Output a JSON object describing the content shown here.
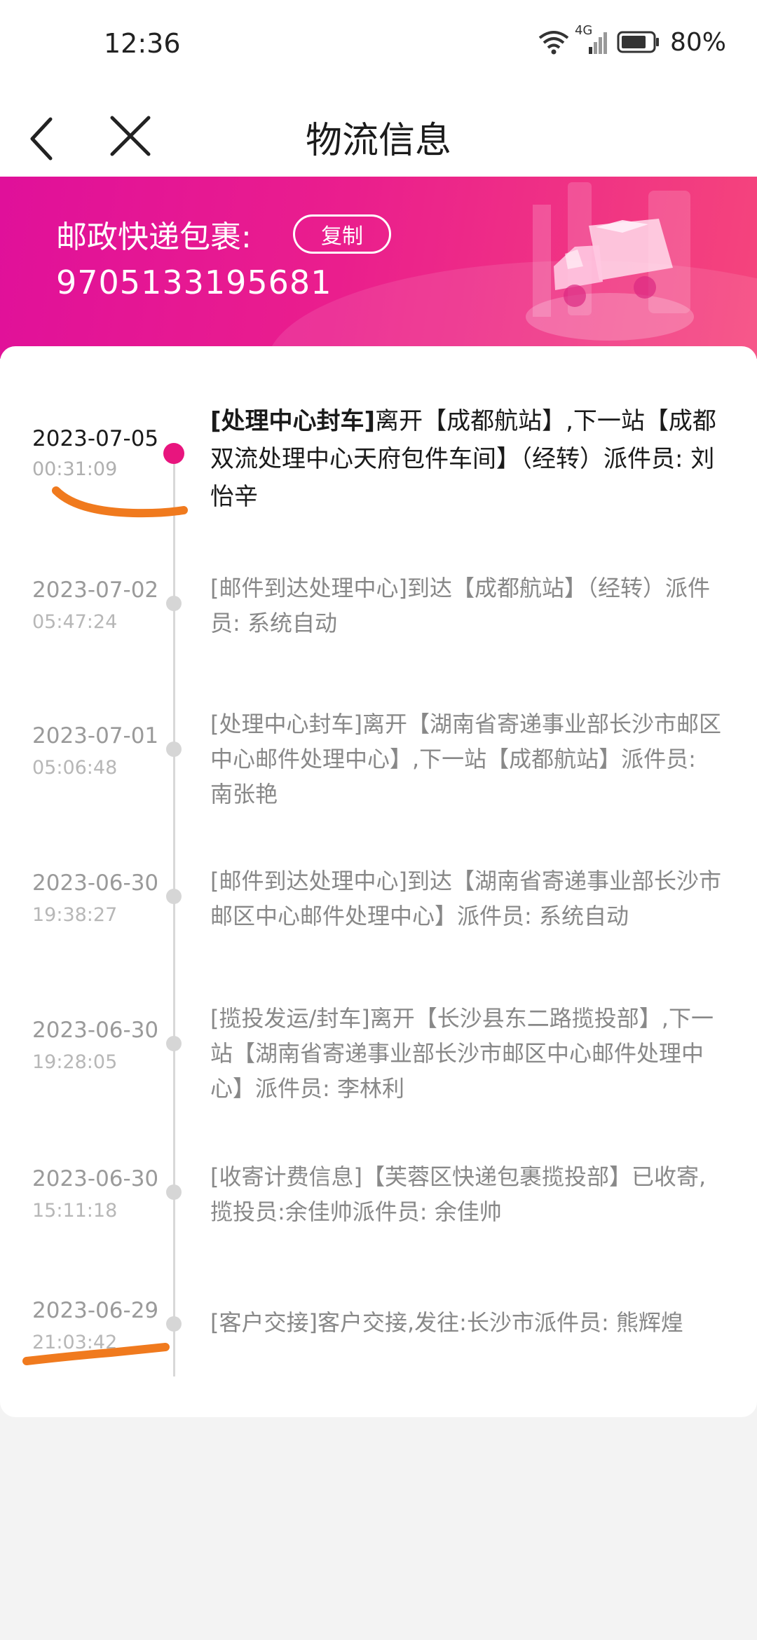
{
  "status_bar": {
    "time": "12:36",
    "network": "4G",
    "battery": "80%"
  },
  "nav": {
    "title": "物流信息",
    "back_icon": "chevron-left-icon",
    "close_icon": "close-icon"
  },
  "banner": {
    "carrier_label": "邮政快递包裹:",
    "copy_label": "复制",
    "tracking_number": "9705133195681",
    "illustration": "delivery-truck-icon"
  },
  "colors": {
    "accent": "#e8157e",
    "banner_start": "#e0109a",
    "banner_end": "#f5457c",
    "annotation": "#f07a1e"
  },
  "events": [
    {
      "date": "2023-07-05",
      "time": "00:31:09",
      "tag": "[处理中心封车]",
      "text": "离开【成都航站】,下一站【成都双流处理中心天府包件车间】（经转）派件员: 刘怡辛",
      "active": true
    },
    {
      "date": "2023-07-02",
      "time": "05:47:24",
      "tag": "[邮件到达处理中心]",
      "text": "到达【成都航站】（经转）派件员: 系统自动",
      "active": false
    },
    {
      "date": "2023-07-01",
      "time": "05:06:48",
      "tag": "[处理中心封车]",
      "text": "离开【湖南省寄递事业部长沙市邮区中心邮件处理中心】,下一站【成都航站】派件员: 南张艳",
      "active": false
    },
    {
      "date": "2023-06-30",
      "time": "19:38:27",
      "tag": "[邮件到达处理中心]",
      "text": "到达【湖南省寄递事业部长沙市邮区中心邮件处理中心】派件员: 系统自动",
      "active": false
    },
    {
      "date": "2023-06-30",
      "time": "19:28:05",
      "tag": "[揽投发运/封车]",
      "text": "离开【长沙县东二路揽投部】,下一站【湖南省寄递事业部长沙市邮区中心邮件处理中心】派件员: 李林利",
      "active": false
    },
    {
      "date": "2023-06-30",
      "time": "15:11:18",
      "tag": "[收寄计费信息]",
      "text": "【芙蓉区快递包裹揽投部】已收寄,揽投员:余佳帅派件员: 余佳帅",
      "active": false
    },
    {
      "date": "2023-06-29",
      "time": "21:03:42",
      "tag": "[客户交接]",
      "text": "客户交接,发往:长沙市派件员: 熊辉煌",
      "active": false
    }
  ]
}
